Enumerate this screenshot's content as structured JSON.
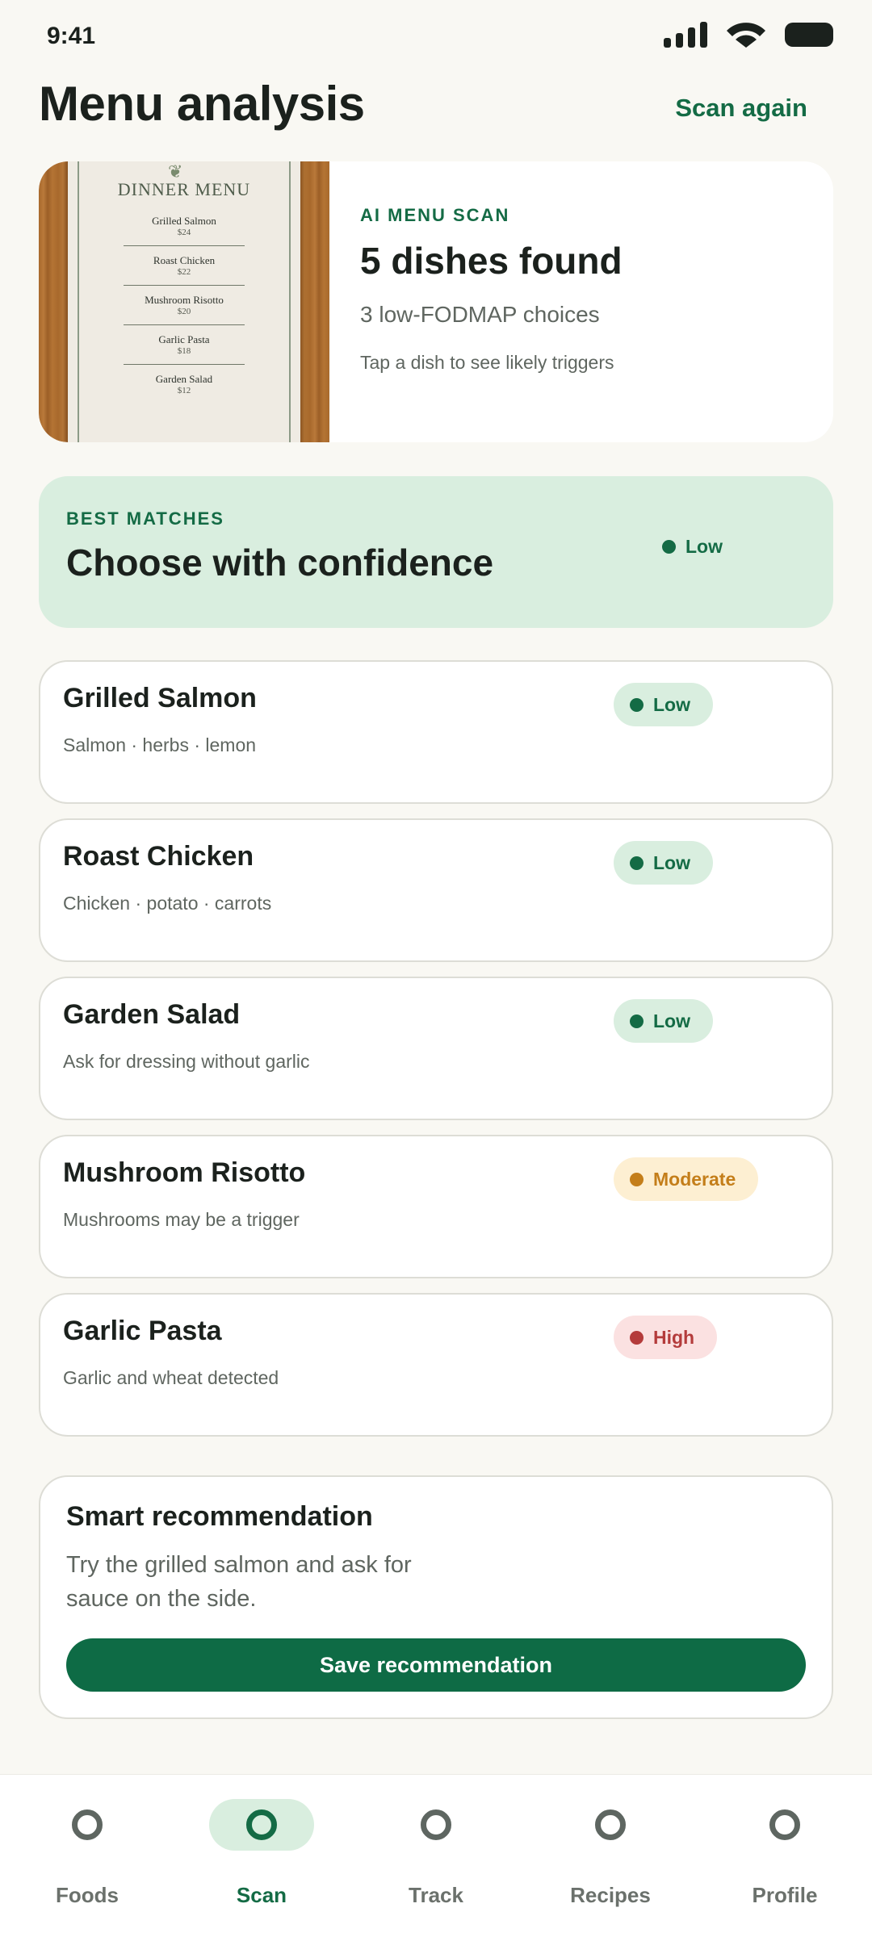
{
  "status_bar": {
    "time": "9:41"
  },
  "header": {
    "title": "Menu analysis",
    "action_label": "Scan again"
  },
  "scan_summary": {
    "photo": {
      "menu_title": "DINNER MENU",
      "items": [
        {
          "name": "Grilled Salmon",
          "price": "$24"
        },
        {
          "name": "Roast Chicken",
          "price": "$22"
        },
        {
          "name": "Mushroom Risotto",
          "price": "$20"
        },
        {
          "name": "Garlic Pasta",
          "price": "$18"
        },
        {
          "name": "Garden Salad",
          "price": "$12"
        }
      ]
    },
    "eyebrow": "AI MENU SCAN",
    "title": "5 dishes found",
    "subtitle": "3 low-FODMAP choices",
    "hint": "Tap a dish to see likely triggers"
  },
  "best_matches": {
    "eyebrow": "BEST MATCHES",
    "title": "Choose with confidence",
    "level": "Low"
  },
  "dishes": [
    {
      "name": "Grilled Salmon",
      "description": "Salmon · herbs · lemon",
      "level": "Low"
    },
    {
      "name": "Roast Chicken",
      "description": "Chicken · potato · carrots",
      "level": "Low"
    },
    {
      "name": "Garden Salad",
      "description": "Ask for dressing without garlic",
      "level": "Low"
    },
    {
      "name": "Mushroom Risotto",
      "description": "Mushrooms may be a trigger",
      "level": "Moderate"
    },
    {
      "name": "Garlic Pasta",
      "description": "Garlic and wheat detected",
      "level": "High"
    }
  ],
  "recommendation": {
    "title": "Smart recommendation",
    "text": "Try the grilled salmon and ask for sauce on the side.",
    "button_label": "Save recommendation"
  },
  "nav": {
    "items": [
      {
        "label": "Foods",
        "icon": "ring-icon",
        "active": false
      },
      {
        "label": "Scan",
        "icon": "ring-icon",
        "active": true
      },
      {
        "label": "Track",
        "icon": "ring-icon",
        "active": false
      },
      {
        "label": "Recipes",
        "icon": "ring-icon",
        "active": false
      },
      {
        "label": "Profile",
        "icon": "ring-icon",
        "active": false
      }
    ]
  },
  "colors": {
    "accent": "#146B45",
    "button": "#0E6B45",
    "low": "#146B45",
    "moderate": "#C47E1A",
    "high": "#B43B3B",
    "background": "#F9F8F3"
  }
}
